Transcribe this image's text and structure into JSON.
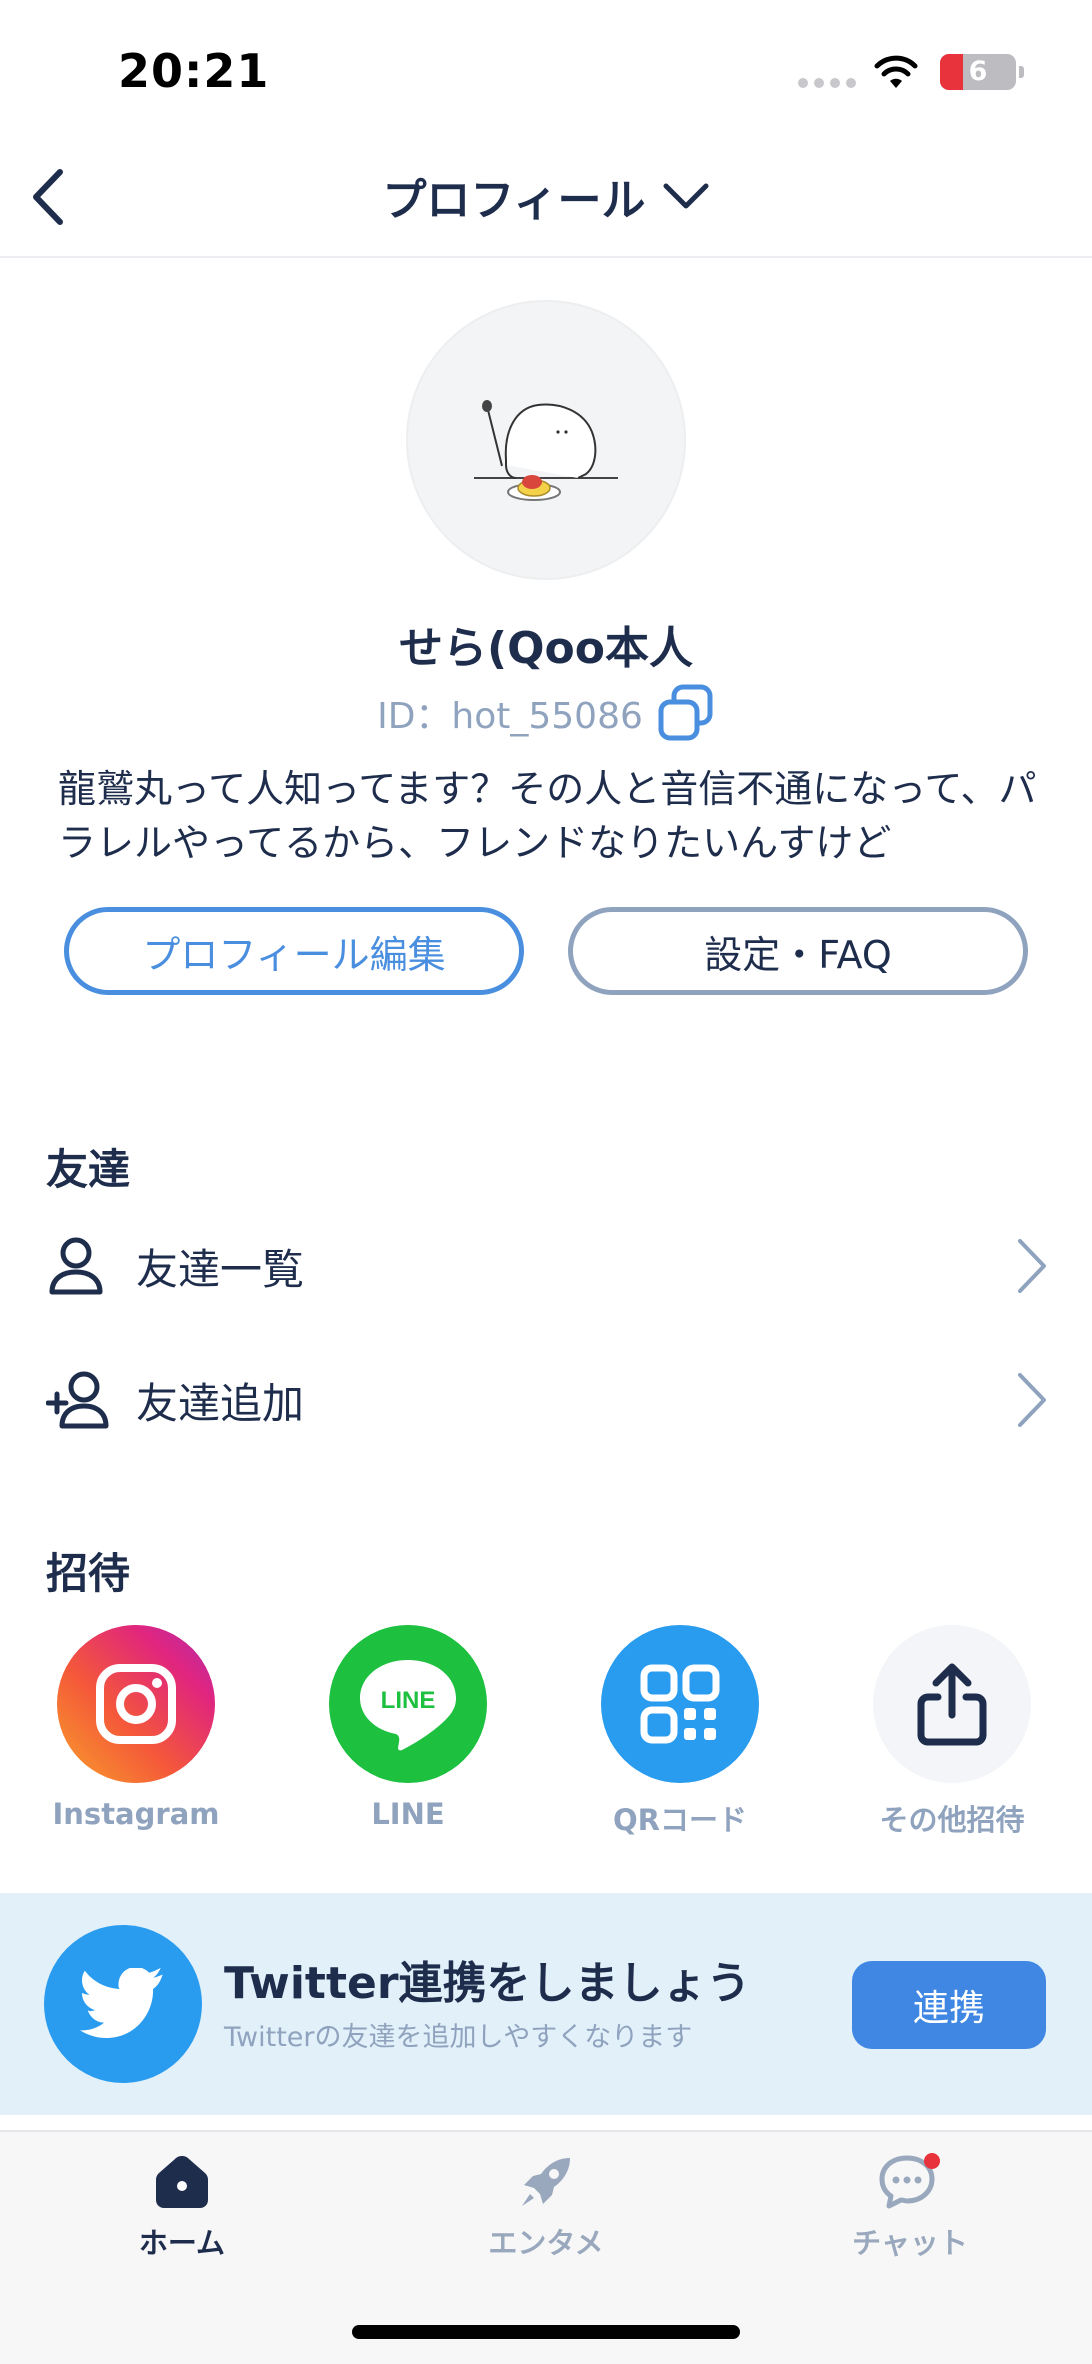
{
  "status_bar": {
    "time": "20:21",
    "battery_level": "6",
    "battery_fraction": 0.3
  },
  "header": {
    "title": "プロフィール"
  },
  "profile": {
    "name": "せら(Qoo本人",
    "id": "ID：hot_55086",
    "bio": "龍鷲丸って人知ってます？その人と音信不通になって、パラレルやってるから、フレンドなりたいんすけど",
    "edit_button": "プロフィール編集",
    "settings_button": "設定・FAQ"
  },
  "friends": {
    "title": "友達",
    "items": [
      {
        "label": "友達一覧",
        "icon": "person-icon"
      },
      {
        "label": "友達追加",
        "icon": "person-add-icon"
      }
    ]
  },
  "invite": {
    "title": "招待",
    "items": [
      {
        "label": "Instagram",
        "icon": "instagram-icon"
      },
      {
        "label": "LINE",
        "icon": "line-icon",
        "icon_text": "LINE"
      },
      {
        "label": "QRコード",
        "icon": "qr-code-icon"
      },
      {
        "label": "その他招待",
        "icon": "share-icon"
      }
    ]
  },
  "twitter_banner": {
    "title": "Twitter連携をしましょう",
    "subtitle": "Twitterの友達を追加しやすくなります",
    "button": "連携"
  },
  "tabs": [
    {
      "label": "ホーム",
      "icon": "home-icon",
      "active": true
    },
    {
      "label": "エンタメ",
      "icon": "rocket-icon",
      "active": false
    },
    {
      "label": "チャット",
      "icon": "chat-icon",
      "active": false,
      "badge": true
    }
  ],
  "colors": {
    "accent": "#4a8fdf",
    "navy": "#1f2d4d",
    "muted": "#8fa3be",
    "twitter": "#2a9cf0",
    "line": "#1dc03f",
    "qr": "#2a9cf0",
    "badge": "#e8333c"
  }
}
